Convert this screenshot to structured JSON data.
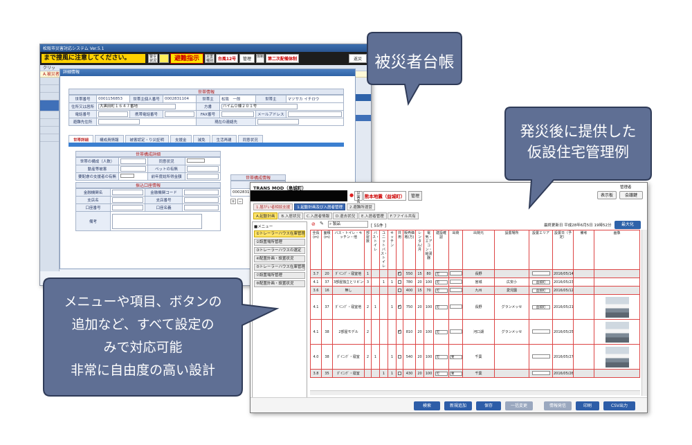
{
  "callouts": {
    "victim_ledger": "被災者台帳",
    "housing_line1": "発災後に提供した",
    "housing_line2": "仮設住宅管理例",
    "design_line1": "メニューや項目、ボタンの",
    "design_line2": "追加など、すべて設定の",
    "design_line3": "みで対応可能",
    "design_line4": "非常に自由度の高い設計"
  },
  "ledger": {
    "app_title": "松阪市災害対応システム Ver.5.1",
    "marquee": "まで捜風に注意してください。",
    "chip_status": "警令\n状況",
    "evacuation": "避難指示",
    "chip_time": "災害\n種別",
    "typhoon": "台風12号",
    "admin": "管理",
    "chip_system": "体制",
    "second_system": "第二次配備体制",
    "right_btn": "返災",
    "nav_item": "クリッ",
    "nav_item2": "1.ライ",
    "sub_item": "A.被災者",
    "dialog_title": "詳細情報",
    "household_section": "世帯情報",
    "fields": {
      "household_no_label": "世帯番号",
      "household_no": "0001156853",
      "head_id_label": "世帯主個人番号",
      "head_id": "0002831104",
      "head_label": "世帯主",
      "head_name": "松阪　一郎",
      "head_kana_label": "世帯主",
      "head_kana": "マツサカ イチロウ",
      "address_label": "住所又は居所",
      "address": "大黒田町１６４７番地",
      "katagaki_label": "方書",
      "katagaki": "ハイム０棟２０１号",
      "phone_label": "電話番号",
      "mobile_label": "携帯電話番号",
      "fax_label": "FAX番号",
      "email_label": "メールアドレス",
      "evac_label": "避難先住所",
      "current_label": "現在の連絡先"
    },
    "tabs": [
      "世帯詳細",
      "構成員情報",
      "被害認定・り災証明",
      "支援金",
      "減免",
      "生活再建",
      "同意状況"
    ],
    "detail_section": "世帯構成詳細",
    "detail": {
      "members_label": "世帯の構成（人数）",
      "consent_label": "同意状況",
      "pet_owner_label": "動産等被害",
      "pet_label": "ペットの有無",
      "support_label": "要配慮の支援者の有無",
      "income_label": "前年度総所得金額"
    },
    "bank_section": "振込口座情報",
    "bank": {
      "bank_name_label": "金融機関名",
      "bank_code_label": "金融機関コード",
      "branch_label": "支店名",
      "branch_no_label": "支店番号",
      "account_no_label": "口座番号",
      "account_name_label": "口座名義",
      "note_label": "備考"
    },
    "member_section": "世帯構成情報",
    "member_id_label": "個人番号",
    "member_id": "000283110",
    "bottom_btn": "検"
  },
  "housing": {
    "app_name": "TRANS MOD（島城町）",
    "dot": "●",
    "chip_disaster": "災害\n名称",
    "area_name": "熊本地震（益城町）",
    "manager": "管理",
    "user_name": "管理者",
    "display_btn": "表示板",
    "meeting_btn": "会議鍵",
    "nav_tabs": [
      "1.届がい者相談支援",
      "1.起動計画及び入居者管理",
      "2.避難所運営"
    ],
    "sub_tabs": [
      "A.起動計画",
      "B.入居状況",
      "C.入居者情報",
      "D.退去状況",
      "E.入居者管理",
      "F.ファイル共有"
    ],
    "menu_header": "■メニュー",
    "menu_items": [
      "①トレーラーハウス在庫管理",
      "②設置場所管理",
      "③トレーラーハウスの選定",
      "④配置計画・設置状況",
      "⑤トレーラーハウス在庫管理",
      "⑦設置場所管理",
      "⑧配置計画・設置状況"
    ],
    "search_label": "⌕ 製品",
    "count": "[ 55件 ]",
    "last_updated": "最終更新日 平成28年6月5日 19時52分",
    "maximize": "最大化",
    "columns": [
      "全長(m)",
      "面積(m)",
      "バス・トイレ・キッチン・他",
      "部屋数",
      "バス・トイレ",
      "ユニットバス・トイレ",
      "キッチン",
      "共用",
      "販売価格(万)",
      "レンタル/月",
      "電気・エアコン・給湯器",
      "建設確認",
      "出荷",
      "出荷元",
      "設置場所",
      "設置エリア",
      "設置日（予定）",
      "備考",
      "画像"
    ],
    "rows": [
      {
        "len": "3.7",
        "area": "20",
        "type": "ﾀﾞｲﾆﾝｸﾞ・寝室他",
        "rooms": "1",
        "c5": "",
        "c6": "",
        "c7": "",
        "shared": "on",
        "price": "550",
        "rent": "15",
        "elec": "80",
        "check": "可",
        "ship": "",
        "origin": "長野",
        "site": "",
        "zone": "",
        "date": "2016/05/14",
        "note": "",
        "photo": false,
        "gray": true
      },
      {
        "len": "4.1",
        "area": "37",
        "type": "3部屋独立とリビング",
        "rooms": "3",
        "c5": "",
        "c6": "1",
        "c7": "1",
        "shared": "off",
        "price": "780",
        "rent": "20",
        "elec": "100",
        "check": "可",
        "ship": "",
        "origin": "宮城",
        "site": "広安小",
        "zone": "益城町",
        "date": "2016/05/23",
        "note": "",
        "photo": false,
        "gray": false
      },
      {
        "len": "3.6",
        "area": "16",
        "type": "無し",
        "rooms": "",
        "c5": "",
        "c6": "",
        "c7": "",
        "shared": "off",
        "price": "400",
        "rent": "15",
        "elec": "70",
        "check": "可",
        "ship": "",
        "origin": "九州",
        "site": "愛児園",
        "zone": "益城町",
        "date": "2016/05/12",
        "note": "",
        "photo": false,
        "gray": true
      },
      {
        "len": "4.1",
        "area": "37",
        "type": "ﾀﾞｲﾆﾝｸﾞ・寝室他",
        "rooms": "2",
        "c5": "1",
        "c6": "",
        "c7": "1",
        "shared": "on",
        "price": "750",
        "rent": "20",
        "elec": "100",
        "check": "可",
        "ship": "",
        "origin": "長野",
        "site": "グランメッセ",
        "zone": "益城町",
        "date": "2016/05/21",
        "note": "",
        "photo": true,
        "gray": false
      },
      {
        "len": "4.1",
        "area": "38",
        "type": "2部屋モデル",
        "rooms": "2",
        "c5": "",
        "c6": "",
        "c7": "",
        "shared": "on",
        "price": "810",
        "rent": "20",
        "elec": "100",
        "check": "可",
        "ship": "",
        "origin": "河口湖",
        "site": "グランメッセ",
        "zone": "",
        "date": "2016/05/25",
        "note": "",
        "photo": true,
        "gray": false
      },
      {
        "len": "4.0",
        "area": "38",
        "type": "ﾀﾞｲﾆﾝｸﾞ・寝室",
        "rooms": "2",
        "c5": "1",
        "c6": "",
        "c7": "1",
        "shared": "off",
        "price": "540",
        "rent": "20",
        "elec": "100",
        "check": "可",
        "ship": "要",
        "origin": "千葉",
        "site": "",
        "zone": "",
        "date": "2016/05/27",
        "note": "",
        "photo": true,
        "gray": false
      },
      {
        "len": "3.8",
        "area": "35",
        "type": "ﾀﾞｲﾆﾝｸﾞ・寝室",
        "rooms": "",
        "c5": "",
        "c6": "1",
        "c7": "1",
        "shared": "off",
        "price": "430",
        "rent": "20",
        "elec": "100",
        "check": "可",
        "ship": "要",
        "origin": "千葉",
        "site": "",
        "zone": "",
        "date": "2016/05/26",
        "note": "",
        "photo": false,
        "gray": true
      }
    ],
    "buttons": [
      "検索",
      "新規追加",
      "保存",
      "一括変更",
      "情報発信",
      "印刷",
      "CSV出力"
    ]
  }
}
